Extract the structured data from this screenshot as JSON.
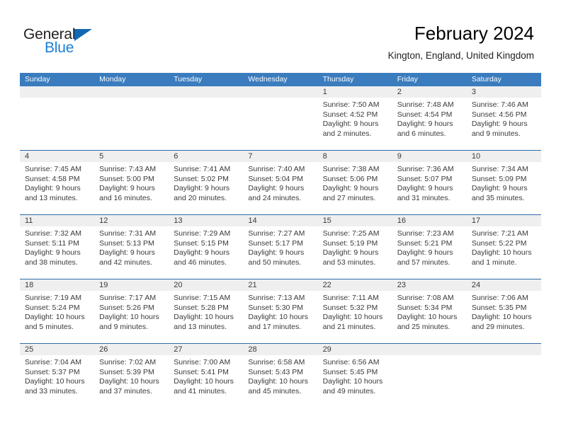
{
  "brand": {
    "name_top": "General",
    "name_bottom": "Blue",
    "triangle_icon": "triangle-icon",
    "color_dark": "#231f20",
    "color_blue": "#1a7fd4"
  },
  "header": {
    "title": "February 2024",
    "subtitle": "Kington, England, United Kingdom"
  },
  "theme": {
    "header_bg": "#3a7cbe",
    "header_text": "#ffffff",
    "date_band_bg": "#efefef",
    "cell_bg": "#ffffff",
    "separator": "#2f6ca8",
    "body_text": "#3a3a3a"
  },
  "calendar": {
    "weekday_headers": [
      "Sunday",
      "Monday",
      "Tuesday",
      "Wednesday",
      "Thursday",
      "Friday",
      "Saturday"
    ],
    "labels": {
      "sunrise": "Sunrise:",
      "sunset": "Sunset:",
      "daylight": "Daylight:"
    },
    "weeks": [
      [
        {
          "date": "",
          "lines": []
        },
        {
          "date": "",
          "lines": []
        },
        {
          "date": "",
          "lines": []
        },
        {
          "date": "",
          "lines": []
        },
        {
          "date": "1",
          "lines": [
            "Sunrise: 7:50 AM",
            "Sunset: 4:52 PM",
            "Daylight: 9 hours and 2 minutes."
          ]
        },
        {
          "date": "2",
          "lines": [
            "Sunrise: 7:48 AM",
            "Sunset: 4:54 PM",
            "Daylight: 9 hours and 6 minutes."
          ]
        },
        {
          "date": "3",
          "lines": [
            "Sunrise: 7:46 AM",
            "Sunset: 4:56 PM",
            "Daylight: 9 hours and 9 minutes."
          ]
        }
      ],
      [
        {
          "date": "4",
          "lines": [
            "Sunrise: 7:45 AM",
            "Sunset: 4:58 PM",
            "Daylight: 9 hours and 13 minutes."
          ]
        },
        {
          "date": "5",
          "lines": [
            "Sunrise: 7:43 AM",
            "Sunset: 5:00 PM",
            "Daylight: 9 hours and 16 minutes."
          ]
        },
        {
          "date": "6",
          "lines": [
            "Sunrise: 7:41 AM",
            "Sunset: 5:02 PM",
            "Daylight: 9 hours and 20 minutes."
          ]
        },
        {
          "date": "7",
          "lines": [
            "Sunrise: 7:40 AM",
            "Sunset: 5:04 PM",
            "Daylight: 9 hours and 24 minutes."
          ]
        },
        {
          "date": "8",
          "lines": [
            "Sunrise: 7:38 AM",
            "Sunset: 5:06 PM",
            "Daylight: 9 hours and 27 minutes."
          ]
        },
        {
          "date": "9",
          "lines": [
            "Sunrise: 7:36 AM",
            "Sunset: 5:07 PM",
            "Daylight: 9 hours and 31 minutes."
          ]
        },
        {
          "date": "10",
          "lines": [
            "Sunrise: 7:34 AM",
            "Sunset: 5:09 PM",
            "Daylight: 9 hours and 35 minutes."
          ]
        }
      ],
      [
        {
          "date": "11",
          "lines": [
            "Sunrise: 7:32 AM",
            "Sunset: 5:11 PM",
            "Daylight: 9 hours and 38 minutes."
          ]
        },
        {
          "date": "12",
          "lines": [
            "Sunrise: 7:31 AM",
            "Sunset: 5:13 PM",
            "Daylight: 9 hours and 42 minutes."
          ]
        },
        {
          "date": "13",
          "lines": [
            "Sunrise: 7:29 AM",
            "Sunset: 5:15 PM",
            "Daylight: 9 hours and 46 minutes."
          ]
        },
        {
          "date": "14",
          "lines": [
            "Sunrise: 7:27 AM",
            "Sunset: 5:17 PM",
            "Daylight: 9 hours and 50 minutes."
          ]
        },
        {
          "date": "15",
          "lines": [
            "Sunrise: 7:25 AM",
            "Sunset: 5:19 PM",
            "Daylight: 9 hours and 53 minutes."
          ]
        },
        {
          "date": "16",
          "lines": [
            "Sunrise: 7:23 AM",
            "Sunset: 5:21 PM",
            "Daylight: 9 hours and 57 minutes."
          ]
        },
        {
          "date": "17",
          "lines": [
            "Sunrise: 7:21 AM",
            "Sunset: 5:22 PM",
            "Daylight: 10 hours and 1 minute."
          ]
        }
      ],
      [
        {
          "date": "18",
          "lines": [
            "Sunrise: 7:19 AM",
            "Sunset: 5:24 PM",
            "Daylight: 10 hours and 5 minutes."
          ]
        },
        {
          "date": "19",
          "lines": [
            "Sunrise: 7:17 AM",
            "Sunset: 5:26 PM",
            "Daylight: 10 hours and 9 minutes."
          ]
        },
        {
          "date": "20",
          "lines": [
            "Sunrise: 7:15 AM",
            "Sunset: 5:28 PM",
            "Daylight: 10 hours and 13 minutes."
          ]
        },
        {
          "date": "21",
          "lines": [
            "Sunrise: 7:13 AM",
            "Sunset: 5:30 PM",
            "Daylight: 10 hours and 17 minutes."
          ]
        },
        {
          "date": "22",
          "lines": [
            "Sunrise: 7:11 AM",
            "Sunset: 5:32 PM",
            "Daylight: 10 hours and 21 minutes."
          ]
        },
        {
          "date": "23",
          "lines": [
            "Sunrise: 7:08 AM",
            "Sunset: 5:34 PM",
            "Daylight: 10 hours and 25 minutes."
          ]
        },
        {
          "date": "24",
          "lines": [
            "Sunrise: 7:06 AM",
            "Sunset: 5:35 PM",
            "Daylight: 10 hours and 29 minutes."
          ]
        }
      ],
      [
        {
          "date": "25",
          "lines": [
            "Sunrise: 7:04 AM",
            "Sunset: 5:37 PM",
            "Daylight: 10 hours and 33 minutes."
          ]
        },
        {
          "date": "26",
          "lines": [
            "Sunrise: 7:02 AM",
            "Sunset: 5:39 PM",
            "Daylight: 10 hours and 37 minutes."
          ]
        },
        {
          "date": "27",
          "lines": [
            "Sunrise: 7:00 AM",
            "Sunset: 5:41 PM",
            "Daylight: 10 hours and 41 minutes."
          ]
        },
        {
          "date": "28",
          "lines": [
            "Sunrise: 6:58 AM",
            "Sunset: 5:43 PM",
            "Daylight: 10 hours and 45 minutes."
          ]
        },
        {
          "date": "29",
          "lines": [
            "Sunrise: 6:56 AM",
            "Sunset: 5:45 PM",
            "Daylight: 10 hours and 49 minutes."
          ]
        },
        {
          "date": "",
          "lines": []
        },
        {
          "date": "",
          "lines": []
        }
      ]
    ]
  }
}
